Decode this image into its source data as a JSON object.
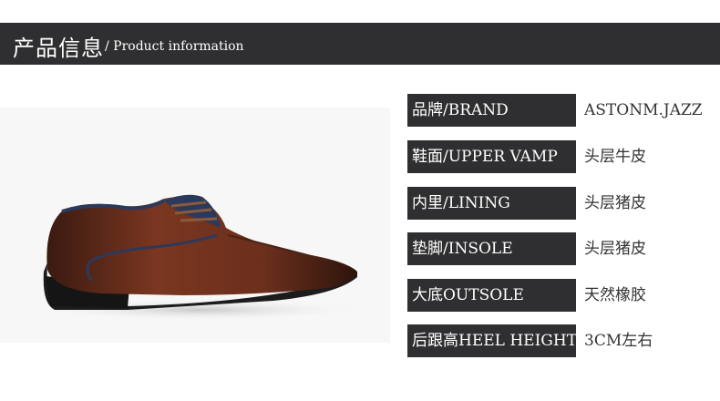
{
  "header": {
    "title_cn": "产品信息",
    "title_en": "/ Product information"
  },
  "colors": {
    "header_bg": "#2f2f31",
    "label_bg": "#2f2f31",
    "shoe_leather": "#6b2f1c",
    "shoe_trim": "#2b3a5c"
  },
  "image": {
    "subject": "brown-leather-derby-shoe"
  },
  "specs": [
    {
      "label": "品牌/BRAND",
      "value": "ASTONM.JAZZ"
    },
    {
      "label": "鞋面/UPPER VAMP",
      "value": "头层牛皮"
    },
    {
      "label": "内里/LINING",
      "value": "头层猪皮"
    },
    {
      "label": "垫脚/INSOLE",
      "value": "头层猪皮"
    },
    {
      "label": "大底OUTSOLE",
      "value": "天然橡胶"
    },
    {
      "label": "后跟高HEEL HEIGHT",
      "value": "3CM左右"
    }
  ]
}
